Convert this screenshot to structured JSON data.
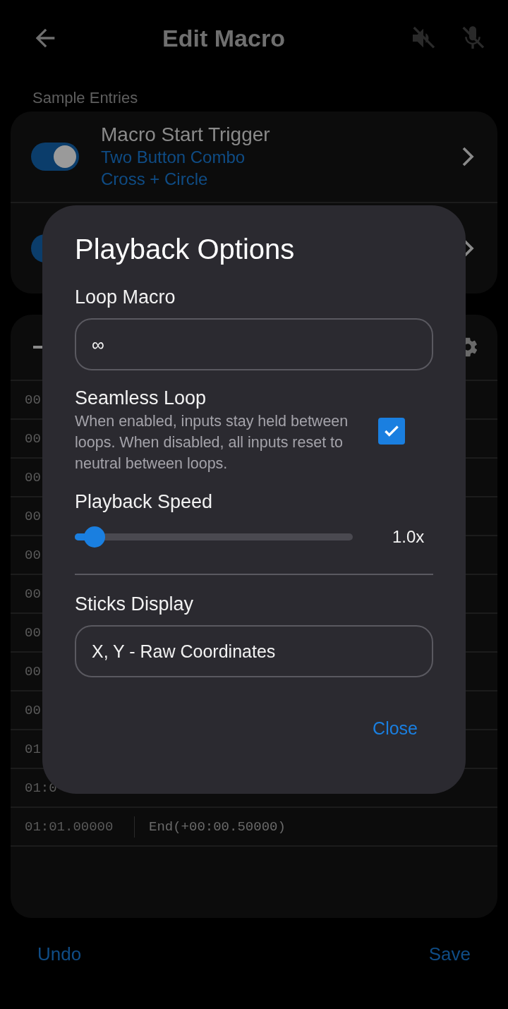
{
  "app_bar": {
    "title": "Edit Macro"
  },
  "section_label": "Sample Entries",
  "entries": [
    {
      "title": "Macro Start Trigger",
      "subtitle_lines": [
        "Two Button Combo",
        "Cross + Circle"
      ],
      "on": true
    },
    {
      "on": true
    }
  ],
  "timeline": {
    "rows": [
      {
        "time": "00"
      },
      {
        "time": "00"
      },
      {
        "time": "00"
      },
      {
        "time": "00"
      },
      {
        "time": "00"
      },
      {
        "time": "00"
      },
      {
        "time": "00"
      },
      {
        "time": "00"
      },
      {
        "time": "00"
      },
      {
        "time": "01"
      },
      {
        "time": "01:0"
      },
      {
        "time": "01:01.00000",
        "event": "End(+00:00.50000)"
      }
    ]
  },
  "dialog": {
    "title": "Playback Options",
    "loop_label": "Loop Macro",
    "loop_value": "∞",
    "seamless_title": "Seamless Loop",
    "seamless_description": "When enabled, inputs stay held between loops. When disabled, all inputs reset to neutral between loops.",
    "seamless_checked": true,
    "speed_label": "Playback Speed",
    "speed": {
      "level": 0.07,
      "reading": "1.0x"
    },
    "sticks_label": "Sticks Display",
    "sticks_value": "X, Y - Raw Coordinates",
    "close": "Close"
  },
  "bottom_bar": {
    "undo": "Undo",
    "save": "Save"
  }
}
